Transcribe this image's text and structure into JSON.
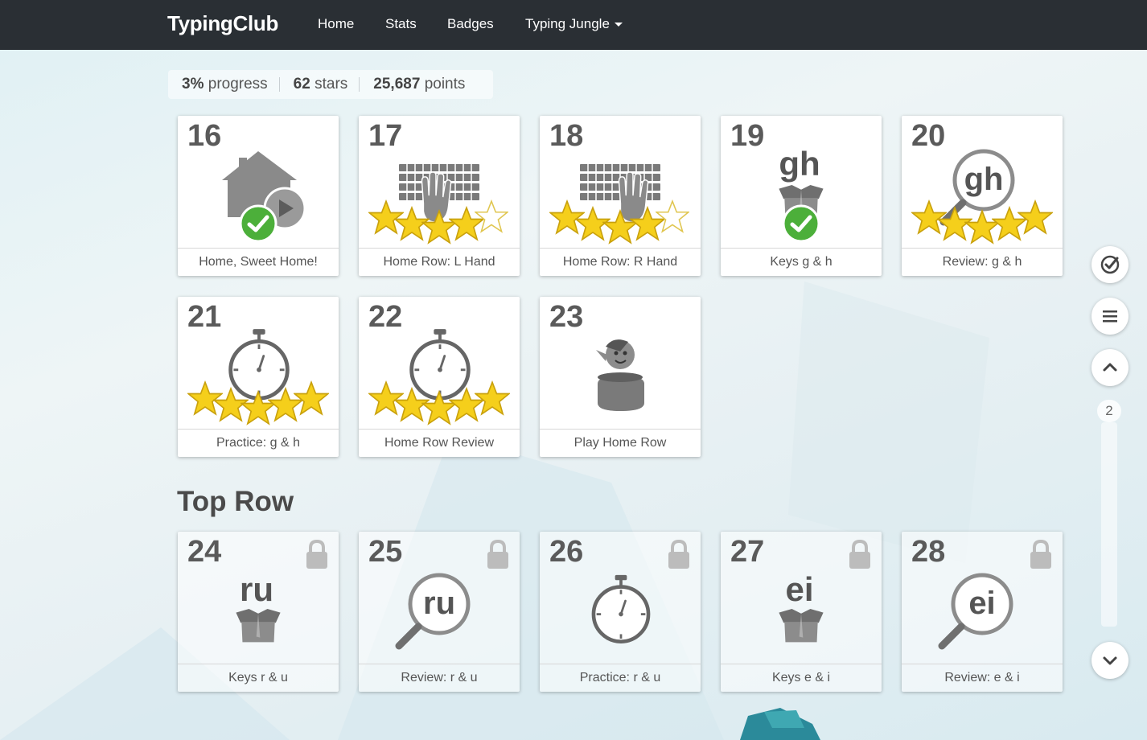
{
  "nav": {
    "brand": "TypingClub",
    "links": [
      "Home",
      "Stats",
      "Badges",
      "Typing Jungle"
    ]
  },
  "stats": {
    "progress_value": "3%",
    "progress_label": "progress",
    "stars_value": "62",
    "stars_label": "stars",
    "points_value": "25,687",
    "points_label": "points"
  },
  "lessons": [
    {
      "num": "16",
      "title": "Home, Sweet Home!",
      "icon": "house-play-icon",
      "status": "completed"
    },
    {
      "num": "17",
      "title": "Home Row: L Hand",
      "icon": "keyboard-left-hand-icon",
      "stars": 4
    },
    {
      "num": "18",
      "title": "Home Row: R Hand",
      "icon": "keyboard-right-hand-icon",
      "stars": 4
    },
    {
      "num": "19",
      "title": "Keys g & h",
      "icon": "box-keys-icon",
      "keys": "gh",
      "status": "completed"
    },
    {
      "num": "20",
      "title": "Review: g & h",
      "icon": "magnifier-keys-icon",
      "keys": "gh",
      "stars": 5
    },
    {
      "num": "21",
      "title": "Practice: g & h",
      "icon": "stopwatch-icon",
      "stars": 5
    },
    {
      "num": "22",
      "title": "Home Row Review",
      "icon": "stopwatch-icon",
      "stars": 5
    },
    {
      "num": "23",
      "title": "Play Home Row",
      "icon": "game-character-icon"
    }
  ],
  "section": {
    "title": "Top Row"
  },
  "locked_lessons": [
    {
      "num": "24",
      "title": "Keys r & u",
      "icon": "box-keys-icon",
      "keys": "ru"
    },
    {
      "num": "25",
      "title": "Review: r & u",
      "icon": "magnifier-keys-icon",
      "keys": "ru"
    },
    {
      "num": "26",
      "title": "Practice: r & u",
      "icon": "stopwatch-icon"
    },
    {
      "num": "27",
      "title": "Keys e & i",
      "icon": "box-keys-icon",
      "keys": "ei"
    },
    {
      "num": "28",
      "title": "Review: e & i",
      "icon": "magnifier-keys-icon",
      "keys": "ei"
    }
  ],
  "sidebar": {
    "page_indicator": "2"
  },
  "colors": {
    "navbar": "#2a2f34",
    "star_gold": "#f5cf1b",
    "check_green": "#4caf3a",
    "icon_grey": "#888888"
  }
}
